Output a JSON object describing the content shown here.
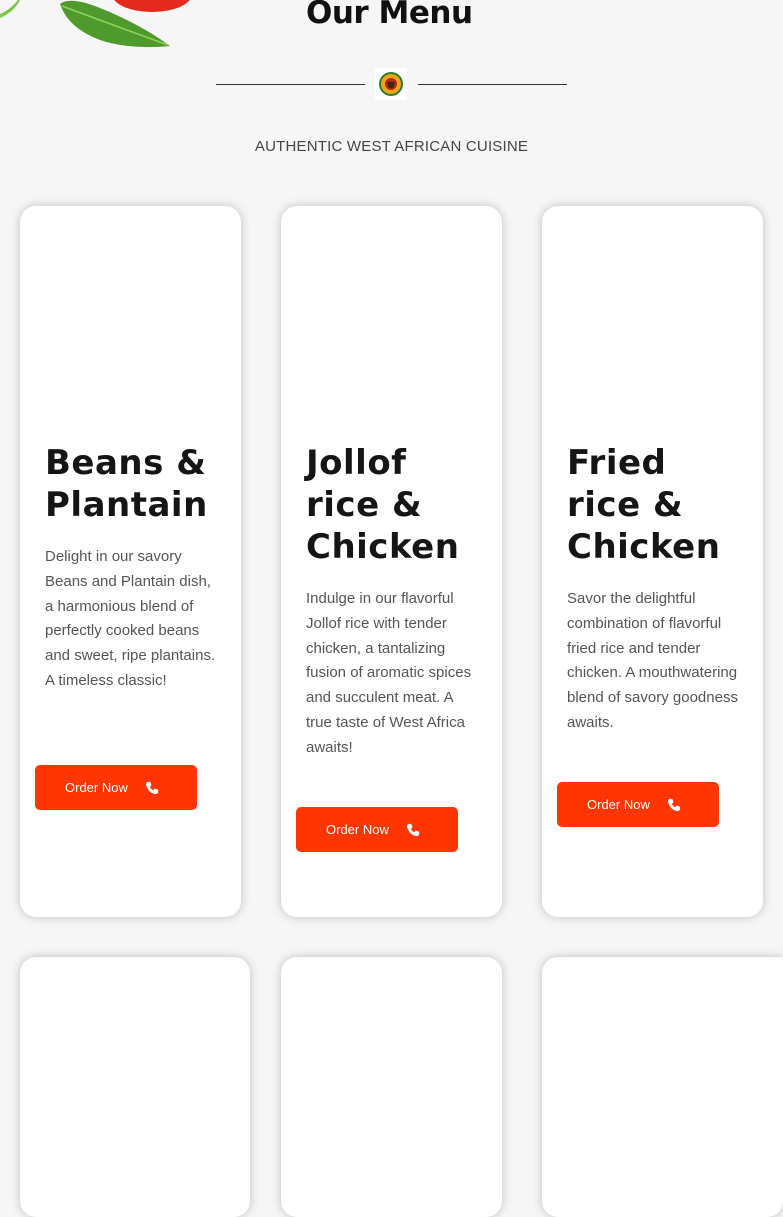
{
  "header": {
    "title": "Our Menu",
    "subtitle": "AUTHENTIC WEST AFRICAN CUISINE"
  },
  "colors": {
    "accent": "#ff3503",
    "background": "#f6f6f6",
    "card": "#ffffff"
  },
  "icons": {
    "decor": "tomato-basil-image",
    "logo": "restaurant-logo-icon",
    "button": "phone-icon"
  },
  "menu_items": [
    {
      "title_lines": [
        "Beans &",
        "Plantain"
      ],
      "description": "Delight in our savory Beans and Plantain dish, a harmonious blend of perfectly cooked beans and sweet, ripe plantains. A timeless classic!",
      "button_label": "Order Now"
    },
    {
      "title_lines": [
        "Jollof",
        "rice &",
        "Chicken"
      ],
      "description": "Indulge in our flavorful Jollof rice with tender chicken, a tantalizing fusion of aromatic spices and succulent meat. A true taste of West Africa awaits!",
      "button_label": "Order Now"
    },
    {
      "title_lines": [
        "Fried",
        "rice &",
        "Chicken"
      ],
      "description": "Savor the delightful combination of flavorful fried rice and tender chicken. A mouthwatering blend of savory goodness awaits.",
      "button_label": "Order Now"
    }
  ]
}
